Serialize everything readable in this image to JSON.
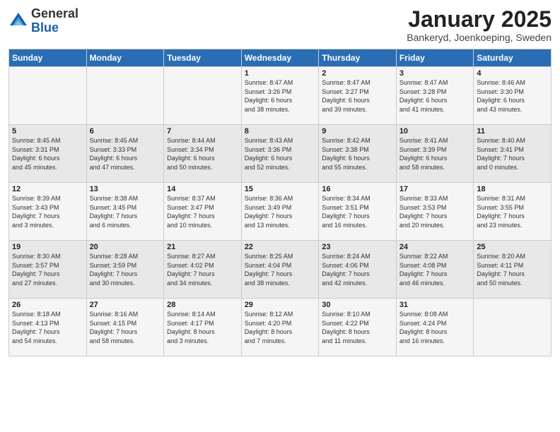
{
  "header": {
    "logo_general": "General",
    "logo_blue": "Blue",
    "month": "January 2025",
    "location": "Bankeryd, Joenkoeping, Sweden"
  },
  "days_of_week": [
    "Sunday",
    "Monday",
    "Tuesday",
    "Wednesday",
    "Thursday",
    "Friday",
    "Saturday"
  ],
  "weeks": [
    [
      {
        "day": "",
        "info": ""
      },
      {
        "day": "",
        "info": ""
      },
      {
        "day": "",
        "info": ""
      },
      {
        "day": "1",
        "info": "Sunrise: 8:47 AM\nSunset: 3:26 PM\nDaylight: 6 hours\nand 38 minutes."
      },
      {
        "day": "2",
        "info": "Sunrise: 8:47 AM\nSunset: 3:27 PM\nDaylight: 6 hours\nand 39 minutes."
      },
      {
        "day": "3",
        "info": "Sunrise: 8:47 AM\nSunset: 3:28 PM\nDaylight: 6 hours\nand 41 minutes."
      },
      {
        "day": "4",
        "info": "Sunrise: 8:46 AM\nSunset: 3:30 PM\nDaylight: 6 hours\nand 43 minutes."
      }
    ],
    [
      {
        "day": "5",
        "info": "Sunrise: 8:45 AM\nSunset: 3:31 PM\nDaylight: 6 hours\nand 45 minutes."
      },
      {
        "day": "6",
        "info": "Sunrise: 8:45 AM\nSunset: 3:33 PM\nDaylight: 6 hours\nand 47 minutes."
      },
      {
        "day": "7",
        "info": "Sunrise: 8:44 AM\nSunset: 3:34 PM\nDaylight: 6 hours\nand 50 minutes."
      },
      {
        "day": "8",
        "info": "Sunrise: 8:43 AM\nSunset: 3:36 PM\nDaylight: 6 hours\nand 52 minutes."
      },
      {
        "day": "9",
        "info": "Sunrise: 8:42 AM\nSunset: 3:38 PM\nDaylight: 6 hours\nand 55 minutes."
      },
      {
        "day": "10",
        "info": "Sunrise: 8:41 AM\nSunset: 3:39 PM\nDaylight: 6 hours\nand 58 minutes."
      },
      {
        "day": "11",
        "info": "Sunrise: 8:40 AM\nSunset: 3:41 PM\nDaylight: 7 hours\nand 0 minutes."
      }
    ],
    [
      {
        "day": "12",
        "info": "Sunrise: 8:39 AM\nSunset: 3:43 PM\nDaylight: 7 hours\nand 3 minutes."
      },
      {
        "day": "13",
        "info": "Sunrise: 8:38 AM\nSunset: 3:45 PM\nDaylight: 7 hours\nand 6 minutes."
      },
      {
        "day": "14",
        "info": "Sunrise: 8:37 AM\nSunset: 3:47 PM\nDaylight: 7 hours\nand 10 minutes."
      },
      {
        "day": "15",
        "info": "Sunrise: 8:36 AM\nSunset: 3:49 PM\nDaylight: 7 hours\nand 13 minutes."
      },
      {
        "day": "16",
        "info": "Sunrise: 8:34 AM\nSunset: 3:51 PM\nDaylight: 7 hours\nand 16 minutes."
      },
      {
        "day": "17",
        "info": "Sunrise: 8:33 AM\nSunset: 3:53 PM\nDaylight: 7 hours\nand 20 minutes."
      },
      {
        "day": "18",
        "info": "Sunrise: 8:31 AM\nSunset: 3:55 PM\nDaylight: 7 hours\nand 23 minutes."
      }
    ],
    [
      {
        "day": "19",
        "info": "Sunrise: 8:30 AM\nSunset: 3:57 PM\nDaylight: 7 hours\nand 27 minutes."
      },
      {
        "day": "20",
        "info": "Sunrise: 8:28 AM\nSunset: 3:59 PM\nDaylight: 7 hours\nand 30 minutes."
      },
      {
        "day": "21",
        "info": "Sunrise: 8:27 AM\nSunset: 4:02 PM\nDaylight: 7 hours\nand 34 minutes."
      },
      {
        "day": "22",
        "info": "Sunrise: 8:25 AM\nSunset: 4:04 PM\nDaylight: 7 hours\nand 38 minutes."
      },
      {
        "day": "23",
        "info": "Sunrise: 8:24 AM\nSunset: 4:06 PM\nDaylight: 7 hours\nand 42 minutes."
      },
      {
        "day": "24",
        "info": "Sunrise: 8:22 AM\nSunset: 4:08 PM\nDaylight: 7 hours\nand 46 minutes."
      },
      {
        "day": "25",
        "info": "Sunrise: 8:20 AM\nSunset: 4:11 PM\nDaylight: 7 hours\nand 50 minutes."
      }
    ],
    [
      {
        "day": "26",
        "info": "Sunrise: 8:18 AM\nSunset: 4:13 PM\nDaylight: 7 hours\nand 54 minutes."
      },
      {
        "day": "27",
        "info": "Sunrise: 8:16 AM\nSunset: 4:15 PM\nDaylight: 7 hours\nand 58 minutes."
      },
      {
        "day": "28",
        "info": "Sunrise: 8:14 AM\nSunset: 4:17 PM\nDaylight: 8 hours\nand 3 minutes."
      },
      {
        "day": "29",
        "info": "Sunrise: 8:12 AM\nSunset: 4:20 PM\nDaylight: 8 hours\nand 7 minutes."
      },
      {
        "day": "30",
        "info": "Sunrise: 8:10 AM\nSunset: 4:22 PM\nDaylight: 8 hours\nand 11 minutes."
      },
      {
        "day": "31",
        "info": "Sunrise: 8:08 AM\nSunset: 4:24 PM\nDaylight: 8 hours\nand 16 minutes."
      },
      {
        "day": "",
        "info": ""
      }
    ]
  ]
}
